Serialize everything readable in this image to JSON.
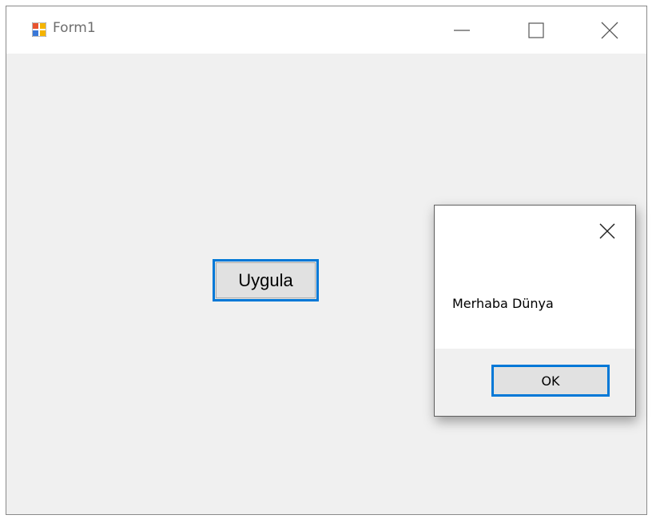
{
  "window": {
    "title": "Form1",
    "icons": {
      "app": "form-app-icon",
      "minimize": "minimize-icon",
      "maximize": "maximize-icon",
      "close": "close-icon"
    }
  },
  "form": {
    "button_label": "Uygula"
  },
  "message_box": {
    "message": "Merhaba Dünya",
    "ok_label": "OK",
    "close_icon": "close-icon"
  },
  "colors": {
    "focus_border": "#0078d7",
    "form_background": "#f0f0f0",
    "button_face": "#e1e1e1"
  }
}
